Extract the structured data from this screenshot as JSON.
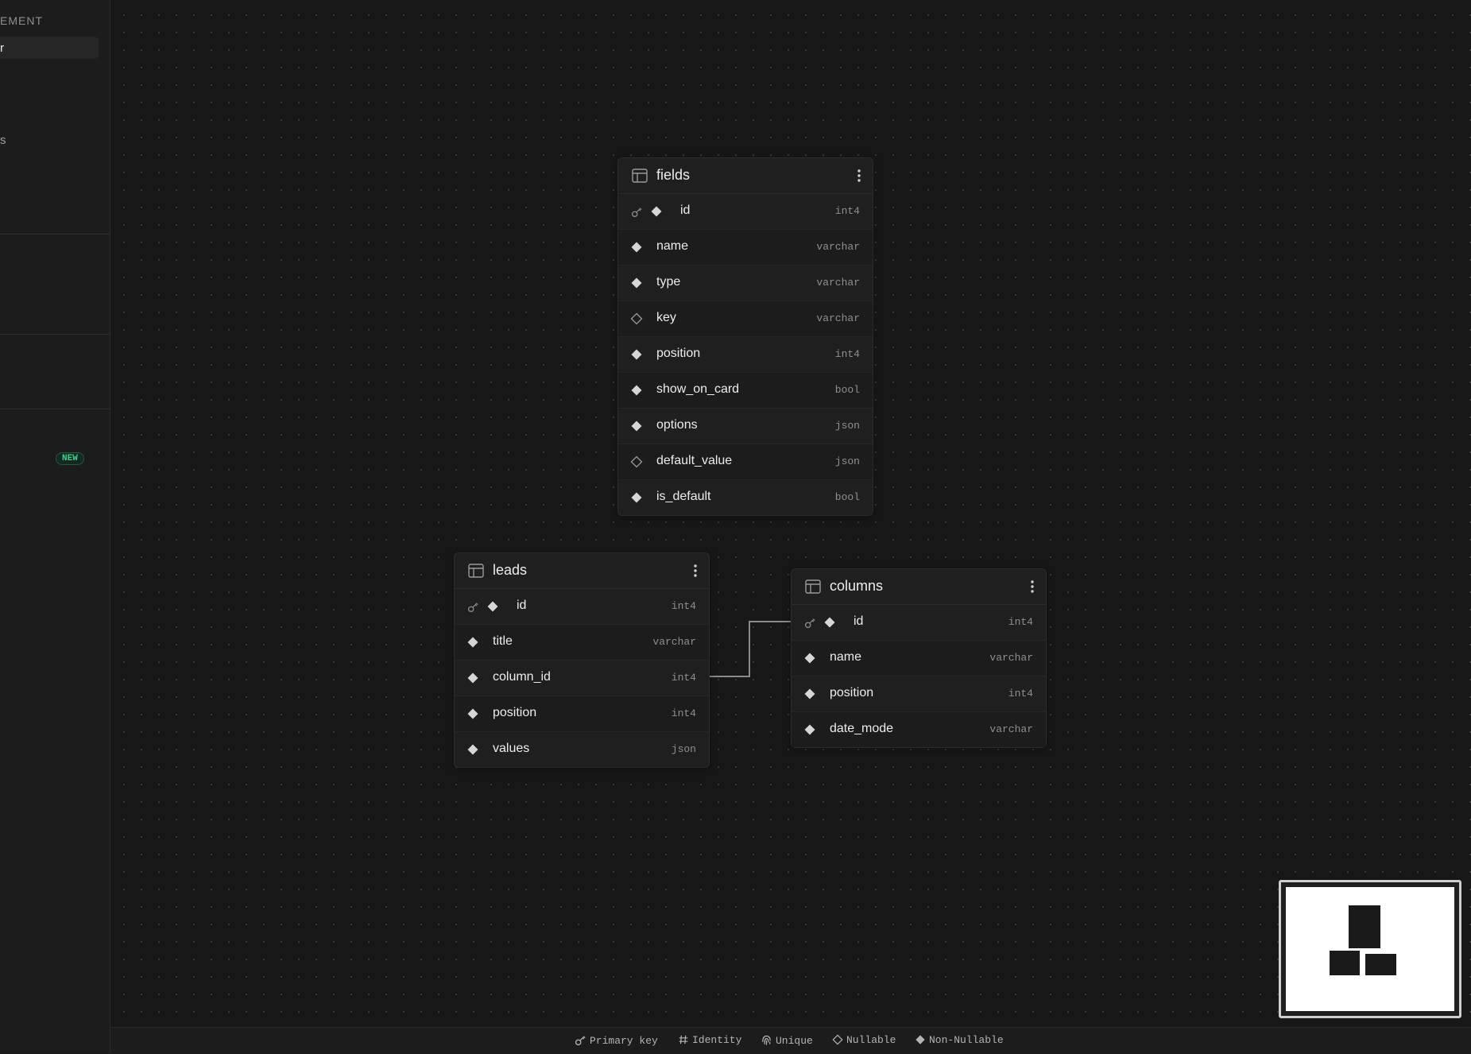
{
  "sidebar": {
    "heading": "EMENT",
    "active_item": "r",
    "item": "s",
    "new_badge": "NEW"
  },
  "tables": [
    {
      "name": "fields",
      "columns": [
        {
          "name": "id",
          "type": "int4",
          "primary_key": true,
          "nullable": false
        },
        {
          "name": "name",
          "type": "varchar",
          "primary_key": false,
          "nullable": false
        },
        {
          "name": "type",
          "type": "varchar",
          "primary_key": false,
          "nullable": false
        },
        {
          "name": "key",
          "type": "varchar",
          "primary_key": false,
          "nullable": true
        },
        {
          "name": "position",
          "type": "int4",
          "primary_key": false,
          "nullable": false
        },
        {
          "name": "show_on_card",
          "type": "bool",
          "primary_key": false,
          "nullable": false
        },
        {
          "name": "options",
          "type": "json",
          "primary_key": false,
          "nullable": false
        },
        {
          "name": "default_value",
          "type": "json",
          "primary_key": false,
          "nullable": true
        },
        {
          "name": "is_default",
          "type": "bool",
          "primary_key": false,
          "nullable": false
        }
      ]
    },
    {
      "name": "leads",
      "columns": [
        {
          "name": "id",
          "type": "int4",
          "primary_key": true,
          "nullable": false
        },
        {
          "name": "title",
          "type": "varchar",
          "primary_key": false,
          "nullable": false
        },
        {
          "name": "column_id",
          "type": "int4",
          "primary_key": false,
          "nullable": false
        },
        {
          "name": "position",
          "type": "int4",
          "primary_key": false,
          "nullable": false
        },
        {
          "name": "values",
          "type": "json",
          "primary_key": false,
          "nullable": false
        }
      ]
    },
    {
      "name": "columns",
      "columns": [
        {
          "name": "id",
          "type": "int4",
          "primary_key": true,
          "nullable": false
        },
        {
          "name": "name",
          "type": "varchar",
          "primary_key": false,
          "nullable": false
        },
        {
          "name": "position",
          "type": "int4",
          "primary_key": false,
          "nullable": false
        },
        {
          "name": "date_mode",
          "type": "varchar",
          "primary_key": false,
          "nullable": false
        }
      ]
    }
  ],
  "legend": {
    "primary_key": "Primary key",
    "identity": "Identity",
    "unique": "Unique",
    "nullable": "Nullable",
    "non_nullable": "Non-Nullable"
  },
  "colors": {
    "background": "#171717",
    "card": "#1f1f1f",
    "accent_green": "#3ecf8e",
    "text": "#ededed",
    "muted": "#8f8f8f"
  }
}
